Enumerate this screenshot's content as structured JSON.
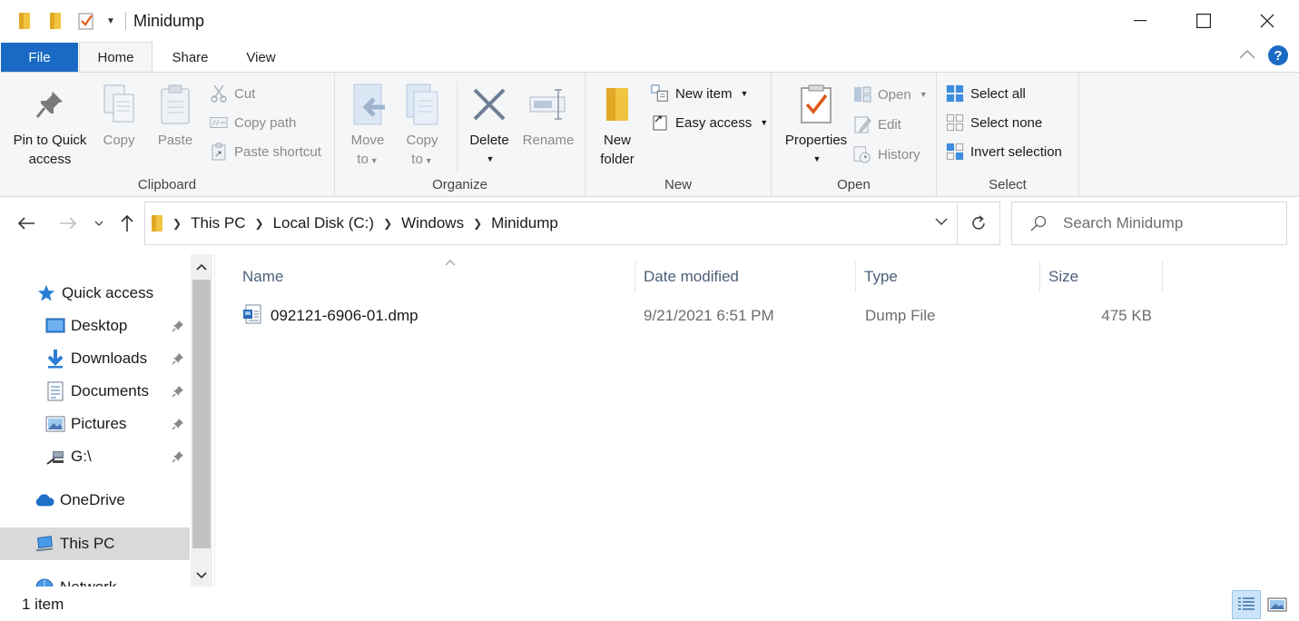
{
  "window": {
    "title": "Minidump",
    "controls": {
      "minimize": "minimize",
      "maximize": "maximize",
      "close": "close"
    }
  },
  "tabs": [
    {
      "label": "File"
    },
    {
      "label": "Home"
    },
    {
      "label": "Share"
    },
    {
      "label": "View"
    }
  ],
  "ribbon": {
    "clipboard": {
      "label": "Clipboard",
      "pin": "Pin to Quick\naccess",
      "pin_line1": "Pin to Quick",
      "pin_line2": "access",
      "copy": "Copy",
      "paste": "Paste",
      "cut": "Cut",
      "copy_path": "Copy path",
      "paste_shortcut": "Paste shortcut"
    },
    "organize": {
      "label": "Organize",
      "move_to_1": "Move",
      "move_to_2": "to",
      "copy_to_1": "Copy",
      "copy_to_2": "to",
      "delete": "Delete",
      "rename": "Rename"
    },
    "new": {
      "label": "New",
      "new_folder_1": "New",
      "new_folder_2": "folder",
      "new_item": "New item",
      "easy_access": "Easy access"
    },
    "open": {
      "label": "Open",
      "properties": "Properties",
      "open": "Open",
      "edit": "Edit",
      "history": "History"
    },
    "select": {
      "label": "Select",
      "select_all": "Select all",
      "select_none": "Select none",
      "invert": "Invert selection"
    }
  },
  "address": {
    "crumbs": [
      "This PC",
      "Local Disk (C:)",
      "Windows",
      "Minidump"
    ]
  },
  "search": {
    "placeholder": "Search Minidump"
  },
  "nav": {
    "quick_access": "Quick access",
    "desktop": "Desktop",
    "downloads": "Downloads",
    "documents": "Documents",
    "pictures": "Pictures",
    "gdrive": "G:\\",
    "onedrive": "OneDrive",
    "this_pc": "This PC",
    "network": "Network"
  },
  "columns": {
    "name": "Name",
    "date": "Date modified",
    "type": "Type",
    "size": "Size"
  },
  "files": [
    {
      "name": "092121-6906-01.dmp",
      "date": "9/21/2021 6:51 PM",
      "type": "Dump File",
      "size": "475 KB"
    }
  ],
  "status": {
    "count": "1 item"
  },
  "colors": {
    "accent": "#1a6ac5",
    "folder": "#f0c341",
    "selected_nav": "#d9d9d9"
  }
}
